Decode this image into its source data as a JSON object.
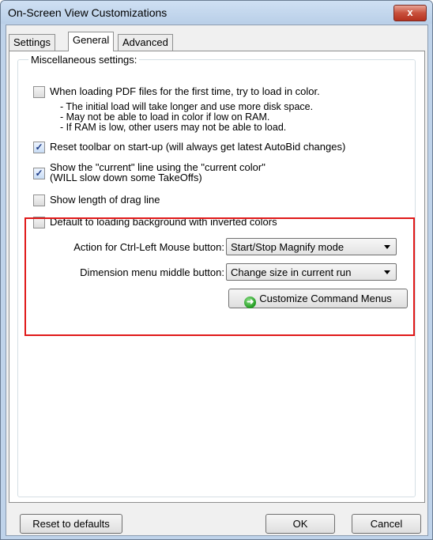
{
  "window": {
    "title": "On-Screen View Customizations",
    "close_glyph": "x"
  },
  "tabs": [
    {
      "label": "Settings"
    },
    {
      "label": "General"
    },
    {
      "label": "Advanced"
    }
  ],
  "group": {
    "label": "Miscellaneous settings:"
  },
  "options": {
    "pdf_color": {
      "label": "When loading PDF files for the first time, try to load in color.",
      "checked": false
    },
    "pdf_notes": [
      "- The initial load will take longer and use more disk space.",
      "- May not be able to load in color if low on RAM.",
      "- If RAM is low, other users may not be able to load."
    ],
    "reset_toolbar": {
      "label": "Reset toolbar on start-up (will always get latest AutoBid changes)",
      "checked": true
    },
    "current_line": {
      "label": "Show the \"current\" line using the \"current color\"",
      "label2": "(WILL slow down some TakeOffs)",
      "checked": true
    },
    "drag_length": {
      "label": "Show length of drag line",
      "checked": false
    },
    "inverted_bg": {
      "label": "Default to loading background with inverted colors",
      "checked": false
    }
  },
  "ctrl_left": {
    "label": "Action for Ctrl-Left Mouse button:",
    "value": "Start/Stop Magnify mode"
  },
  "dim_middle": {
    "label": "Dimension menu middle button:",
    "value": "Change size in current run"
  },
  "customize_button": {
    "label": "Customize Command Menus",
    "icon": "green-arrow-icon"
  },
  "footer": {
    "reset": "Reset to defaults",
    "ok": "OK",
    "cancel": "Cancel"
  },
  "colors": {
    "highlight_border": "#e01919",
    "window_frame": "#bfd3ea"
  }
}
